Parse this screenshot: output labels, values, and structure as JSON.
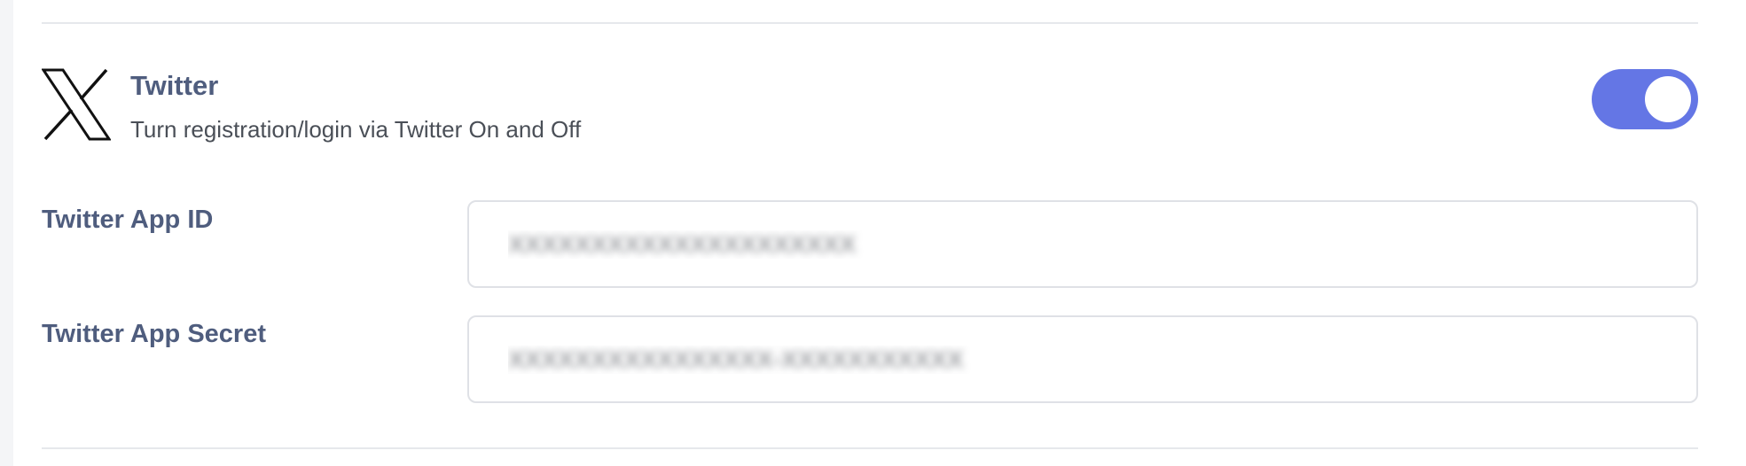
{
  "social_login": {
    "service": {
      "icon": "x-logo-icon",
      "title": "Twitter",
      "description": "Turn registration/login via Twitter On and Off",
      "enabled": true,
      "toggle_color": "#6476e5"
    },
    "fields": [
      {
        "label": "Twitter App ID",
        "value": "XXXXXXXXXXXXXXXXXXXXX"
      },
      {
        "label": "Twitter App Secret",
        "value": "XXXXXXXXXXXXXXXX-XXXXXXXXXXX"
      }
    ]
  }
}
